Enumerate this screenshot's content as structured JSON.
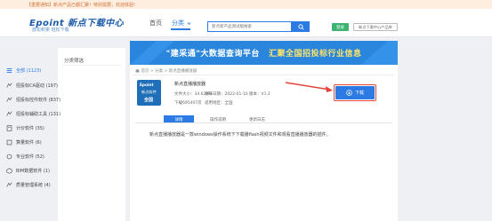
{
  "notice": {
    "text": "【重要通知】新点产品已都汇聚！特别需要，欢迎体验!"
  },
  "header": {
    "logo_text": "Epoint 新点下载中心",
    "logo_sub": "放松积累 轻松下载",
    "nav_home": "首页",
    "nav_category": "分类",
    "search_placeholder": "新点新产品测试版搜索",
    "btn_login": "登录",
    "btn_more": "新点下载中心产品库"
  },
  "sidebar": {
    "title": "分类筛选",
    "items": [
      {
        "label": "全部 (1123)",
        "icon": "list-icon",
        "active": true
      },
      {
        "label": "招投标CA驱动 (197)",
        "icon": "ca-icon",
        "active": false
      },
      {
        "label": "招投标控件软件 (837)",
        "icon": "software-icon",
        "active": false
      },
      {
        "label": "招投标辅助工具 (131)",
        "icon": "tool-icon",
        "active": false
      },
      {
        "label": "计价软件 (35)",
        "icon": "calc-icon",
        "active": false
      },
      {
        "label": "算量软件 (6)",
        "icon": "measure-icon",
        "active": false
      },
      {
        "label": "专业软件 (52)",
        "icon": "pro-icon",
        "active": false
      },
      {
        "label": "BIM数据软件 (1)",
        "icon": "bim-icon",
        "active": false
      },
      {
        "label": "质量管理系统 (4)",
        "icon": "quality-icon",
        "active": false
      }
    ]
  },
  "banner": {
    "part1": "\"建采通\"大数据查询平台",
    "part2": "汇聚全国招投标行业信息"
  },
  "breadcrumb": "首页 > 分类 > 新点直播播放器",
  "software": {
    "icon_line1": "Epoint",
    "icon_line2": "新点软件",
    "icon_line3": "全国",
    "title": "新点直播播放器",
    "size": "文件大小：34.62MB",
    "date": "发布日期：2022-01-10",
    "version": "版本：V1.2",
    "downloads": "下载695407次",
    "region": "适用地区：全国"
  },
  "download_button": "下载",
  "tabs": [
    "详情",
    "操作说明",
    "更新日志"
  ],
  "description": "新点直播播放器是一款windows操作系统下下载播flash视频文件和观看直播播放器的插件。",
  "colors": {
    "primary": "#2c7be5",
    "highlight": "#e4453a",
    "green": "#3cb371"
  }
}
